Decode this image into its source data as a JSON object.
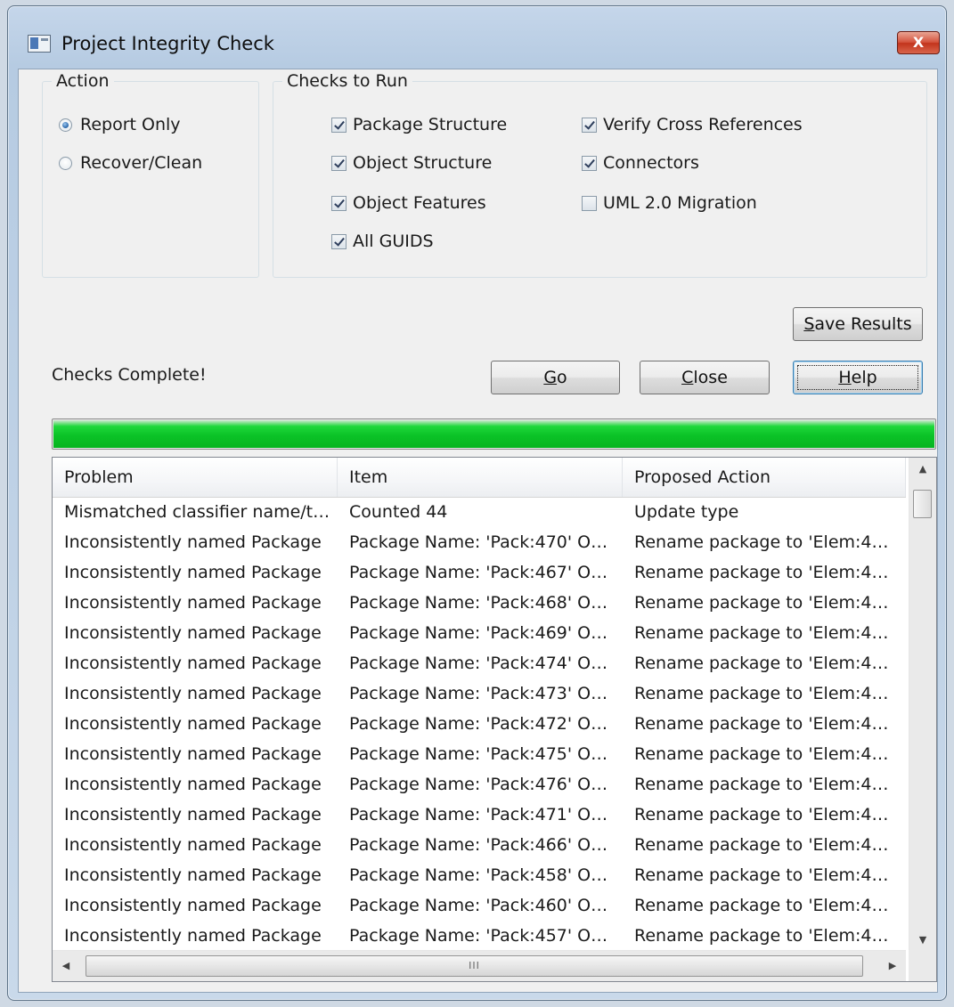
{
  "window": {
    "title": "Project Integrity Check",
    "close_glyph": "X"
  },
  "action_group": {
    "legend": "Action",
    "options": [
      {
        "label": "Report Only",
        "selected": true
      },
      {
        "label": "Recover/Clean",
        "selected": false
      }
    ]
  },
  "checks_group": {
    "legend": "Checks to Run",
    "items": [
      {
        "label": "Package Structure",
        "checked": true
      },
      {
        "label": "Object Structure",
        "checked": true
      },
      {
        "label": "Object Features",
        "checked": true
      },
      {
        "label": "All GUIDS",
        "checked": true
      },
      {
        "label": "Verify Cross References",
        "checked": true
      },
      {
        "label": "Connectors",
        "checked": true
      },
      {
        "label": "UML 2.0 Migration",
        "checked": false
      }
    ]
  },
  "buttons": {
    "save_results": "Save Results",
    "go": "Go",
    "close": "Close",
    "help": "Help"
  },
  "status": "Checks Complete!",
  "progress": {
    "percent": 100,
    "color": "#0bc327"
  },
  "results": {
    "columns": [
      "Problem",
      "Item",
      "Proposed Action"
    ],
    "rows": [
      [
        "Mismatched classifier name/t…",
        "Counted 44",
        "Update type"
      ],
      [
        "Inconsistently named Package",
        "Package Name: 'Pack:470' O…",
        "Rename package to 'Elem:4…"
      ],
      [
        "Inconsistently named Package",
        "Package Name: 'Pack:467' O…",
        "Rename package to 'Elem:4…"
      ],
      [
        "Inconsistently named Package",
        "Package Name: 'Pack:468' O…",
        "Rename package to 'Elem:4…"
      ],
      [
        "Inconsistently named Package",
        "Package Name: 'Pack:469' O…",
        "Rename package to 'Elem:4…"
      ],
      [
        "Inconsistently named Package",
        "Package Name: 'Pack:474' O…",
        "Rename package to 'Elem:4…"
      ],
      [
        "Inconsistently named Package",
        "Package Name: 'Pack:473' O…",
        "Rename package to 'Elem:4…"
      ],
      [
        "Inconsistently named Package",
        "Package Name: 'Pack:472' O…",
        "Rename package to 'Elem:4…"
      ],
      [
        "Inconsistently named Package",
        "Package Name: 'Pack:475' O…",
        "Rename package to 'Elem:4…"
      ],
      [
        "Inconsistently named Package",
        "Package Name: 'Pack:476' O…",
        "Rename package to 'Elem:4…"
      ],
      [
        "Inconsistently named Package",
        "Package Name: 'Pack:471' O…",
        "Rename package to 'Elem:4…"
      ],
      [
        "Inconsistently named Package",
        "Package Name: 'Pack:466' O…",
        "Rename package to 'Elem:4…"
      ],
      [
        "Inconsistently named Package",
        "Package Name: 'Pack:458' O…",
        "Rename package to 'Elem:4…"
      ],
      [
        "Inconsistently named Package",
        "Package Name: 'Pack:460' O…",
        "Rename package to 'Elem:4…"
      ],
      [
        "Inconsistently named Package",
        "Package Name: 'Pack:457' O…",
        "Rename package to 'Elem:4…"
      ]
    ]
  },
  "scrollbars": {
    "h_thumb_glyph": "III"
  }
}
